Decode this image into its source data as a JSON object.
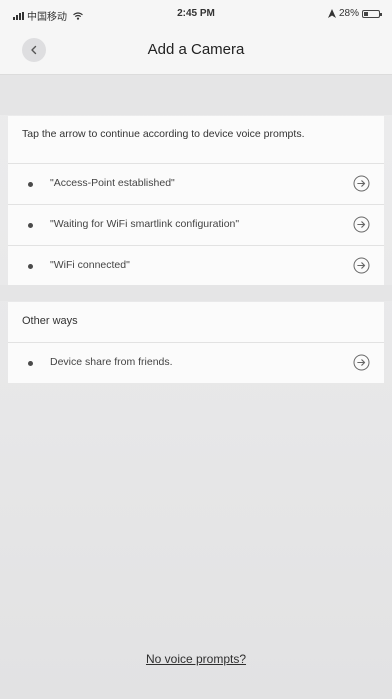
{
  "status_bar": {
    "carrier": "中国移动",
    "time": "2:45 PM",
    "battery": "28%",
    "battery_level": 0.28
  },
  "nav": {
    "title": "Add a Camera",
    "back_icon": "chevron-left-icon"
  },
  "instructions": {
    "text": "Tap the arrow to continue according to device voice prompts.",
    "items": [
      {
        "label": "\"Access-Point established\"",
        "icon": "arrow-right-circle-icon"
      },
      {
        "label": "\"Waiting for WiFi smartlink configuration\"",
        "icon": "arrow-right-circle-icon"
      },
      {
        "label": "\"WiFi connected\"",
        "icon": "arrow-right-circle-icon"
      }
    ]
  },
  "other_ways": {
    "title": "Other ways",
    "items": [
      {
        "label": "Device share from friends.",
        "icon": "arrow-right-circle-icon"
      }
    ]
  },
  "footer": {
    "link": "No voice prompts?"
  },
  "colors": {
    "background": "#e9e9ea",
    "card": "#fbfbfb",
    "text": "#2b2b2b"
  }
}
